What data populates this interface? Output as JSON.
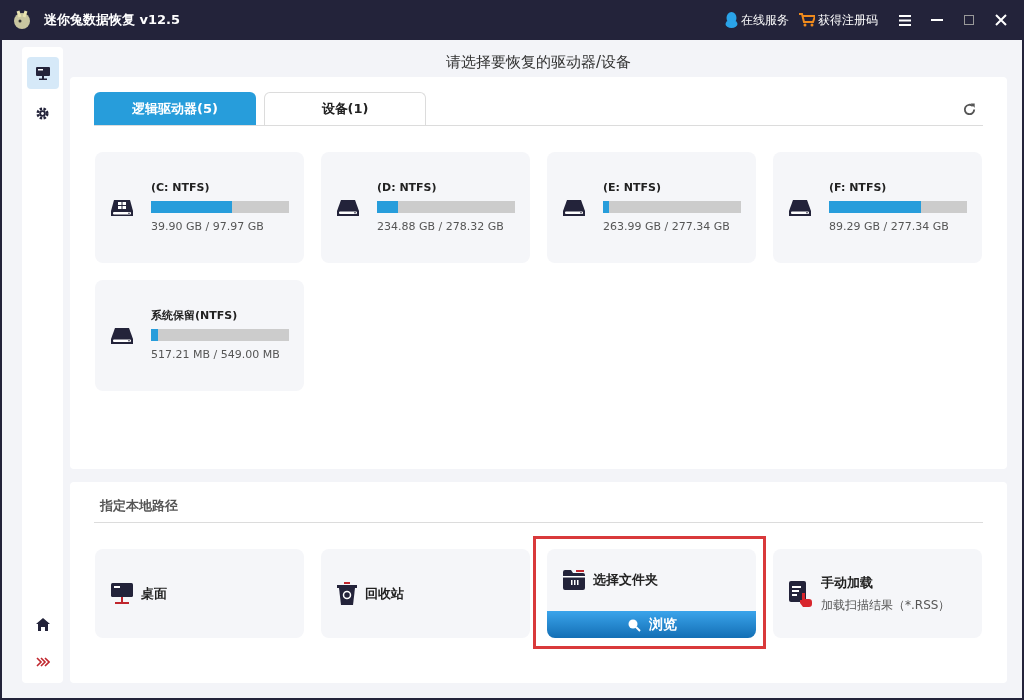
{
  "window": {
    "title": "迷你兔数据恢复 v12.5"
  },
  "title_bar": {
    "links": [
      {
        "kind": "support",
        "label": "在线服务"
      },
      {
        "kind": "cart",
        "label": "获得注册码"
      }
    ]
  },
  "sidebar": {
    "items": [
      {
        "kind": "drives",
        "selected": true
      },
      {
        "kind": "settings",
        "selected": false
      }
    ],
    "bottom_items": [
      {
        "kind": "home"
      },
      {
        "kind": "expand"
      }
    ]
  },
  "heading": "请选择要恢复的驱动器/设备",
  "tabs": [
    {
      "label": "逻辑驱动器(5)",
      "selected": true
    },
    {
      "label": "设备(1)",
      "selected": false
    }
  ],
  "drives": [
    {
      "kind": "windows",
      "name": "(C: NTFS)",
      "level": 0.59,
      "usage": "39.90 GB / 97.97 GB"
    },
    {
      "kind": "disk",
      "name": "(D: NTFS)",
      "level": 0.15,
      "usage": "234.88 GB / 278.32 GB"
    },
    {
      "kind": "disk",
      "name": "(E: NTFS)",
      "level": 0.04,
      "usage": "263.99 GB / 277.34 GB"
    },
    {
      "kind": "disk",
      "name": "(F: NTFS)",
      "level": 0.67,
      "usage": "89.29 GB / 277.34 GB"
    },
    {
      "kind": "disk",
      "name": "系统保留(NTFS)",
      "level": 0.05,
      "usage": "517.21 MB / 549.00 MB"
    }
  ],
  "local_path": {
    "title": "指定本地路径",
    "items": [
      {
        "kind": "desktop",
        "label": "桌面",
        "highlighted": false
      },
      {
        "kind": "recycle",
        "label": "回收站",
        "highlighted": false
      },
      {
        "kind": "folder",
        "label": "选择文件夹",
        "button": "浏览",
        "highlighted": true
      },
      {
        "kind": "load",
        "label": "手动加载",
        "subtitle": "加载扫描结果（*.RSS）",
        "highlighted": false
      }
    ]
  }
}
